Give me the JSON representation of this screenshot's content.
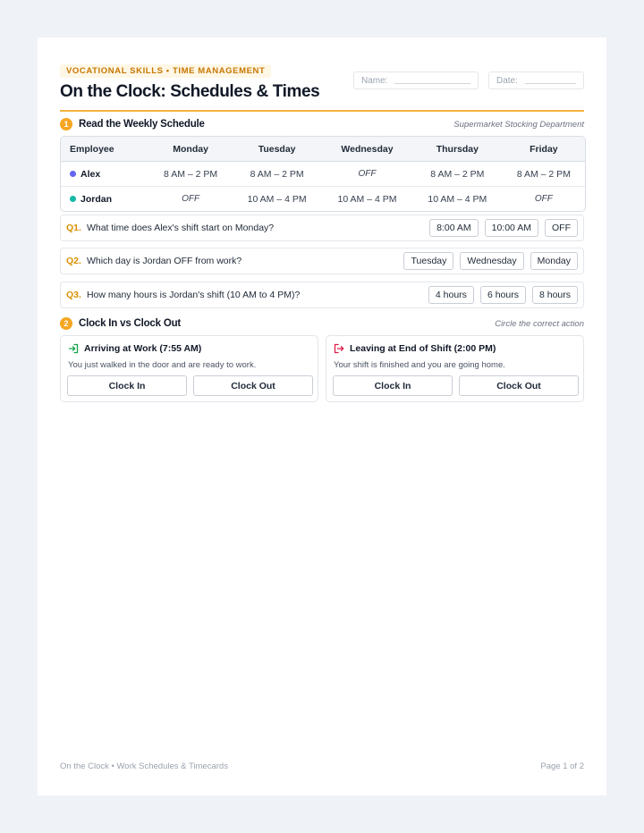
{
  "header": {
    "kicker": "VOCATIONAL SKILLS • TIME MANAGEMENT",
    "title": "On the Clock: Schedules & Times",
    "name_label": "Name:",
    "date_label": "Date:"
  },
  "section1": {
    "number": "1",
    "title": "Read the Weekly Schedule",
    "note": "Supermarket Stocking Department",
    "columns": [
      "Employee",
      "Monday",
      "Tuesday",
      "Wednesday",
      "Thursday",
      "Friday"
    ],
    "rows": [
      {
        "name": "Alex",
        "dot_color": "#6366f1",
        "shifts": [
          "8 AM – 2 PM",
          "8 AM – 2 PM",
          "OFF",
          "8 AM – 2 PM",
          "8 AM – 2 PM"
        ]
      },
      {
        "name": "Jordan",
        "dot_color": "#14b8a6",
        "shifts": [
          "OFF",
          "10 AM – 4 PM",
          "10 AM – 4 PM",
          "10 AM – 4 PM",
          "OFF"
        ]
      }
    ]
  },
  "questions": [
    {
      "num": "Q1.",
      "text": "What time does Alex's shift start on Monday?",
      "options": [
        "8:00 AM",
        "10:00 AM",
        "OFF"
      ]
    },
    {
      "num": "Q2.",
      "text": "Which day is Jordan OFF from work?",
      "options": [
        "Tuesday",
        "Wednesday",
        "Monday"
      ]
    },
    {
      "num": "Q3.",
      "text": "How many hours is Jordan's shift (10 AM to 4 PM)?",
      "options": [
        "4 hours",
        "6 hours",
        "8 hours"
      ]
    }
  ],
  "section2": {
    "number": "2",
    "title": "Clock In vs Clock Out",
    "note": "Circle the correct action",
    "cards": [
      {
        "title": "Arriving at Work (7:55 AM)",
        "desc": "You just walked in the door and are ready to work.",
        "icon": "login-icon",
        "icon_color": "#16a34a",
        "buttons": [
          "Clock In",
          "Clock Out"
        ]
      },
      {
        "title": "Leaving at End of Shift (2:00 PM)",
        "desc": "Your shift is finished and you are going home.",
        "icon": "logout-icon",
        "icon_color": "#e11d48",
        "buttons": [
          "Clock In",
          "Clock Out"
        ]
      }
    ]
  },
  "footer": {
    "left": "On the Clock • Work Schedules & Timecards",
    "right": "Page 1 of 2"
  }
}
